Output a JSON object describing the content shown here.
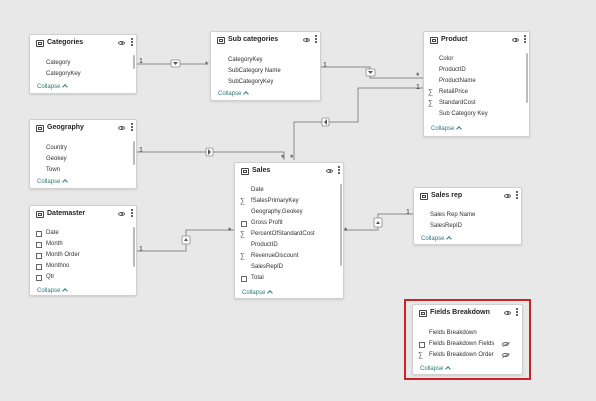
{
  "tables": {
    "categories": {
      "title": "Categories",
      "fields": [
        {
          "label": "Category",
          "icon": ""
        },
        {
          "label": "CategoryKey",
          "icon": ""
        }
      ],
      "collapse": "Collapse"
    },
    "subcategories": {
      "title": "Sub categories",
      "fields": [
        {
          "label": "CategoryKey",
          "icon": ""
        },
        {
          "label": "SubCategory Name",
          "icon": ""
        },
        {
          "label": "SubCategoryKey",
          "icon": ""
        }
      ],
      "collapse": "Collapse"
    },
    "product": {
      "title": "Product",
      "fields": [
        {
          "label": "Color",
          "icon": ""
        },
        {
          "label": "ProductID",
          "icon": ""
        },
        {
          "label": "ProductName",
          "icon": ""
        },
        {
          "label": "RetailPrice",
          "icon": "sigma"
        },
        {
          "label": "StandardCost",
          "icon": "sigma"
        },
        {
          "label": "Sub Category Key",
          "icon": ""
        }
      ],
      "collapse": "Collapse"
    },
    "geography": {
      "title": "Geography",
      "fields": [
        {
          "label": "Country",
          "icon": ""
        },
        {
          "label": "Geokey",
          "icon": ""
        },
        {
          "label": "Town",
          "icon": ""
        }
      ],
      "collapse": "Collapse"
    },
    "sales": {
      "title": "Sales",
      "fields": [
        {
          "label": "Date",
          "icon": ""
        },
        {
          "label": "fSalesPrimaryKey",
          "icon": "sigma"
        },
        {
          "label": "Geography.Geokey",
          "icon": ""
        },
        {
          "label": "Gross Profit",
          "icon": "grid"
        },
        {
          "label": "PercentOfStandardCost",
          "icon": "sigma"
        },
        {
          "label": "ProductID",
          "icon": ""
        },
        {
          "label": "RevenueDiscount",
          "icon": "sigma"
        },
        {
          "label": "SalesRepID",
          "icon": ""
        },
        {
          "label": "Total",
          "icon": "grid"
        }
      ],
      "collapse": "Collapse"
    },
    "salesrep": {
      "title": "Sales rep",
      "fields": [
        {
          "label": "Sales Rep Name",
          "icon": ""
        },
        {
          "label": "SalesRepID",
          "icon": ""
        }
      ],
      "collapse": "Collapse"
    },
    "datemaster": {
      "title": "Datemaster",
      "fields": [
        {
          "label": "Date",
          "icon": "grid"
        },
        {
          "label": "Month",
          "icon": "grid"
        },
        {
          "label": "Month Order",
          "icon": "grid"
        },
        {
          "label": "Monthno",
          "icon": "grid"
        },
        {
          "label": "Qtr",
          "icon": "grid"
        }
      ],
      "collapse": "Collapse"
    },
    "fieldsbreakdown": {
      "title": "Fields Breakdown",
      "fields": [
        {
          "label": "Fields Breakdown",
          "icon": "",
          "hidden": false
        },
        {
          "label": "Fields Breakdown Fields",
          "icon": "grid",
          "hidden": true
        },
        {
          "label": "Fields Breakdown Order",
          "icon": "sigma",
          "hidden": true
        }
      ],
      "collapse": "Collapse"
    }
  },
  "relationships": {
    "one_label": "1",
    "many_label": "*"
  },
  "colors": {
    "line": "#8a8a8a",
    "highlight": "#c8232c",
    "collapse": "#2b7a78"
  }
}
